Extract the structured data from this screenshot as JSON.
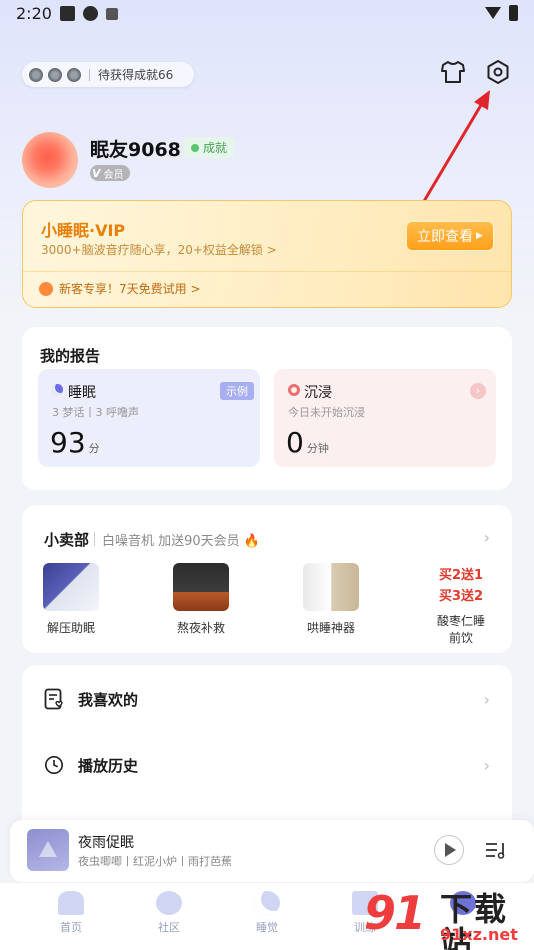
{
  "status_bar": {
    "time": "2:20"
  },
  "header": {
    "achievement_text": "待获得成就66",
    "icons": [
      "tshirt-icon",
      "settings-hexagon-icon"
    ]
  },
  "profile": {
    "username": "眠友9068",
    "achievement_badge": "成就",
    "vip_badge_letter": "V",
    "vip_badge_text": "会员"
  },
  "vip_card": {
    "title": "小睡眠·VIP",
    "subtitle": "3000+脑波音疗随心享，20+权益全解锁 >",
    "button": "立即查看",
    "free_trial": "新客专享！7天免费试用 >"
  },
  "report": {
    "title": "我的报告",
    "sleep": {
      "title": "睡眠",
      "tag": "示例",
      "sub": "3 梦话丨3 呼噜声",
      "value": "93",
      "unit": "分"
    },
    "immerse": {
      "title": "沉浸",
      "sub": "今日未开始沉浸",
      "value": "0",
      "unit": "分钟"
    }
  },
  "shop": {
    "title": "小卖部",
    "subtitle": "白噪音机 加送90天会员 🔥",
    "products": [
      {
        "label": "解压助眠"
      },
      {
        "label": "熬夜补救"
      },
      {
        "label": "哄睡神器"
      },
      {
        "label": "酸枣仁睡前饮",
        "label_line1": "酸枣仁睡",
        "label_line2": "前饮",
        "promo1": "买2送1",
        "promo2": "买3送2"
      }
    ]
  },
  "list": {
    "favorites": "我喜欢的",
    "history": "播放历史"
  },
  "player": {
    "title": "夜雨促眠",
    "subtitle": "夜虫唧唧丨红泥小炉丨雨打芭蕉"
  },
  "tabs": [
    "首页",
    "社区",
    "睡觉",
    "训练",
    ""
  ],
  "watermark": {
    "big": "91",
    "brand": "下载站",
    "url": "91xz.net"
  },
  "colors": {
    "vip_orange": "#e87f07",
    "accent_purple": "#6b6ee8",
    "promo_red": "#e23a2b"
  }
}
